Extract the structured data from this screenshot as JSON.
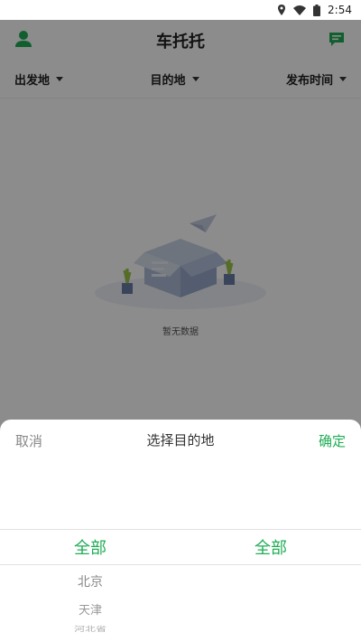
{
  "status": {
    "time": "2:54"
  },
  "header": {
    "title": "车托托"
  },
  "filters": [
    {
      "label": "出发地"
    },
    {
      "label": "目的地"
    },
    {
      "label": "发布时间"
    }
  ],
  "empty": {
    "text": "暂无数据"
  },
  "sheet": {
    "cancel": "取消",
    "title": "选择目的地",
    "confirm": "确定",
    "left_column": {
      "selected": "全部",
      "options": [
        "北京",
        "天津",
        "河北省"
      ]
    },
    "right_column": {
      "selected": "全部"
    }
  },
  "colors": {
    "accent": "#1fad55",
    "overlay": "rgba(0,0,0,0.45)"
  },
  "icons": [
    "location-icon",
    "wifi-icon",
    "battery-icon",
    "user-icon",
    "message-icon",
    "caret-down-icon",
    "paper-plane-icon",
    "box-icon",
    "plant-icon"
  ]
}
